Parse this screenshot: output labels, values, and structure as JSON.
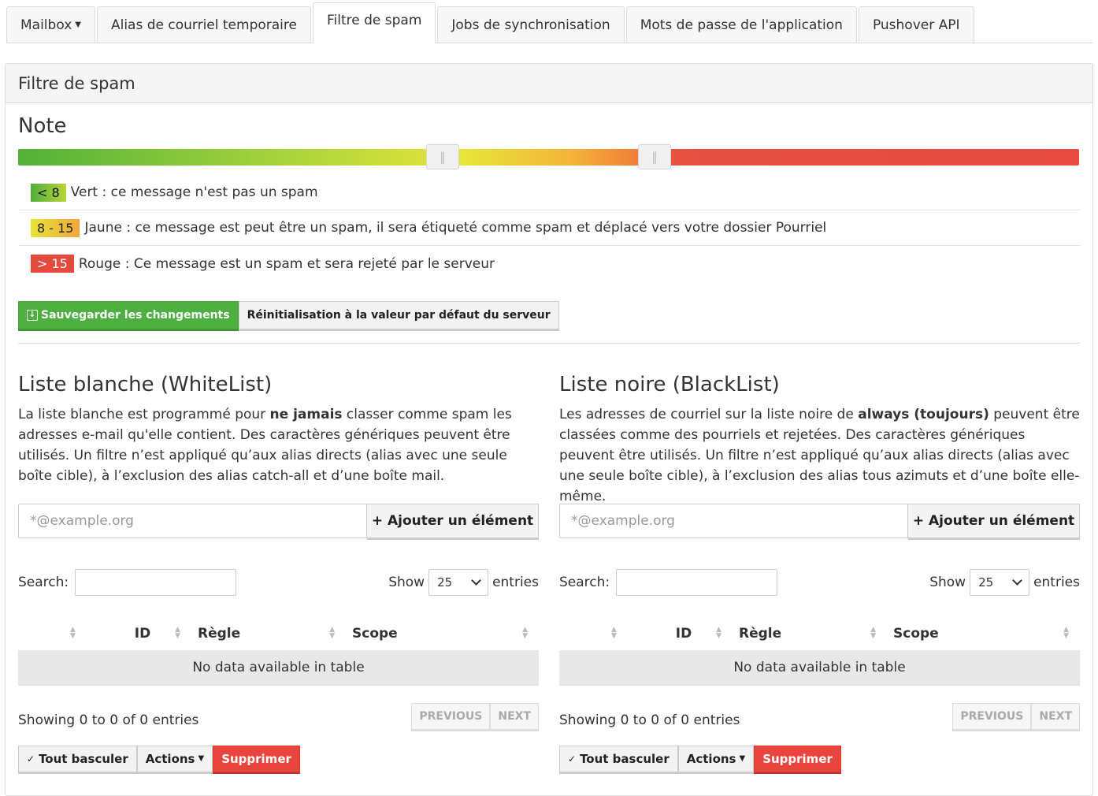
{
  "tabs": [
    {
      "label": "Mailbox",
      "dropdown": true
    },
    {
      "label": "Alias de courriel temporaire"
    },
    {
      "label": "Filtre de spam",
      "active": true
    },
    {
      "label": "Jobs de synchronisation"
    },
    {
      "label": "Mots de passe de l'application"
    },
    {
      "label": "Pushover API"
    }
  ],
  "panel": {
    "title": "Filtre de spam"
  },
  "note": {
    "heading": "Note",
    "slider": {
      "min_handle": 8,
      "max_handle": 15
    },
    "legend": [
      {
        "chip": "< 8",
        "text": "Vert : ce message n'est pas un spam",
        "color": "#4fae3a"
      },
      {
        "chip": "8 - 15",
        "text": "Jaune : ce message est peut être un spam, il sera étiqueté comme spam et déplacé vers votre dossier Pourriel",
        "color": "#e6e43a"
      },
      {
        "chip": "> 15",
        "text": "Rouge : Ce message est un spam et sera rejeté par le serveur",
        "color": "#e54a3f"
      }
    ],
    "save_label": "Sauvegarder les changements",
    "reset_label": "Réinitialisation à la valeur par défaut du serveur"
  },
  "whitelist": {
    "title": "Liste blanche (WhiteList)",
    "desc_pre": "La liste blanche est programmé pour ",
    "desc_bold": "ne jamais",
    "desc_post": " classer comme spam les adresses e-mail qu'elle contient. Des caractères génériques peuvent être utilisés. Un filtre n’est appliqué qu’aux alias directs (alias avec une seule boîte cible), à l’exclusion des alias catch-all et d’une boîte mail.",
    "placeholder": "*@example.org",
    "add_label": "+ Ajouter un élément",
    "search_label": "Search:",
    "show_label": "Show",
    "show_value": "25",
    "entries_label": "entries",
    "columns": [
      "ID",
      "Règle",
      "Scope"
    ],
    "empty": "No data available in table",
    "info": "Showing 0 to 0 of 0 entries",
    "prev": "PREVIOUS",
    "next": "NEXT",
    "toggle_all": "Tout basculer",
    "actions": "Actions",
    "delete": "Supprimer"
  },
  "blacklist": {
    "title": "Liste noire (BlackList)",
    "desc_pre": "Les adresses de courriel sur la liste noire de ",
    "desc_bold": "always (toujours)",
    "desc_post": " peuvent être classées comme des pourriels et rejetées. Des caractères génériques peuvent être utilisés. Un filtre n’est appliqué qu’aux alias directs (alias avec une seule boîte cible), à l’exclusion des alias tous azimuts et d’une boîte elle-même.",
    "placeholder": "*@example.org",
    "add_label": "+ Ajouter un élément",
    "search_label": "Search:",
    "show_label": "Show",
    "show_value": "25",
    "entries_label": "entries",
    "columns": [
      "ID",
      "Règle",
      "Scope"
    ],
    "empty": "No data available in table",
    "info": "Showing 0 to 0 of 0 entries",
    "prev": "PREVIOUS",
    "next": "NEXT",
    "toggle_all": "Tout basculer",
    "actions": "Actions",
    "delete": "Supprimer"
  }
}
